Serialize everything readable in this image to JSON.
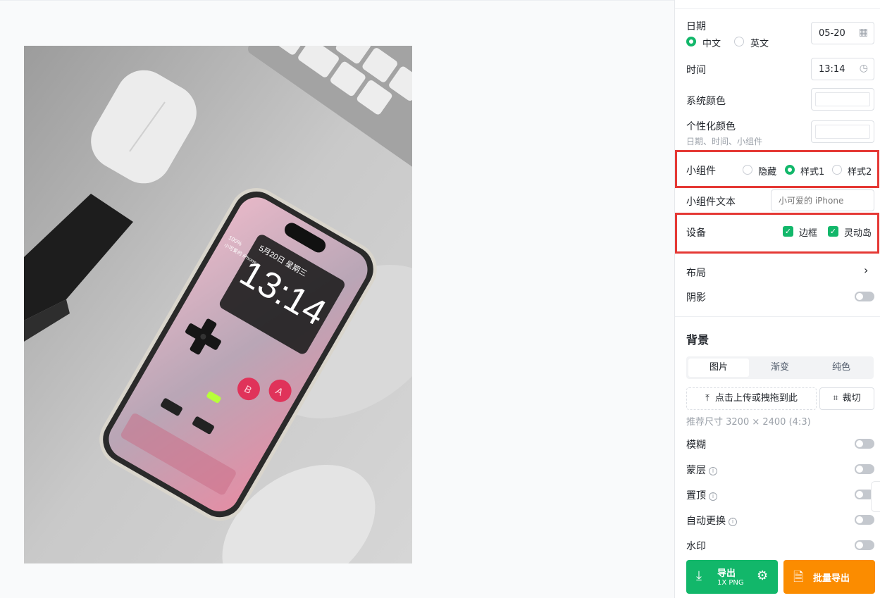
{
  "panel": {
    "date": {
      "label": "日期",
      "value": "05-20",
      "lang_options": [
        "中文",
        "英文"
      ],
      "lang_selected": "中文"
    },
    "time": {
      "label": "时间",
      "value": "13:14"
    },
    "system_color": {
      "label": "系统颜色"
    },
    "personal_color": {
      "label": "个性化颜色",
      "hint": "日期、时间、小组件"
    },
    "widget": {
      "label": "小组件",
      "options": [
        "隐藏",
        "样式1",
        "样式2"
      ],
      "selected": "样式1"
    },
    "widget_text": {
      "label": "小组件文本",
      "placeholder": "小可爱的 iPhone"
    },
    "device": {
      "label": "设备",
      "options": [
        "边框",
        "灵动岛"
      ]
    },
    "layout": {
      "label": "布局"
    },
    "shadow": {
      "label": "阴影"
    },
    "background": {
      "title": "背景",
      "tabs": [
        "图片",
        "渐变",
        "纯色"
      ],
      "upload_label": "点击上传或拽拖到此",
      "crop_label": "裁切",
      "recommend": "推荐尺寸 3200 × 2400 (4:3)",
      "toggles": [
        "模糊",
        "蒙层",
        "置顶",
        "自动更换",
        "水印"
      ]
    },
    "export": {
      "label": "导出",
      "sub": "1X PNG",
      "batch_label": "批量导出"
    }
  },
  "phone": {
    "time": "13:14",
    "date_line": "5月20日 星期三",
    "battery": "100%",
    "owner": "小可爱的 iPhone",
    "btn_b": "B",
    "btn_a": "A"
  },
  "colors": {
    "accent": "#12b76a",
    "highlight": "#e53935",
    "batch": "#fb8c00"
  }
}
